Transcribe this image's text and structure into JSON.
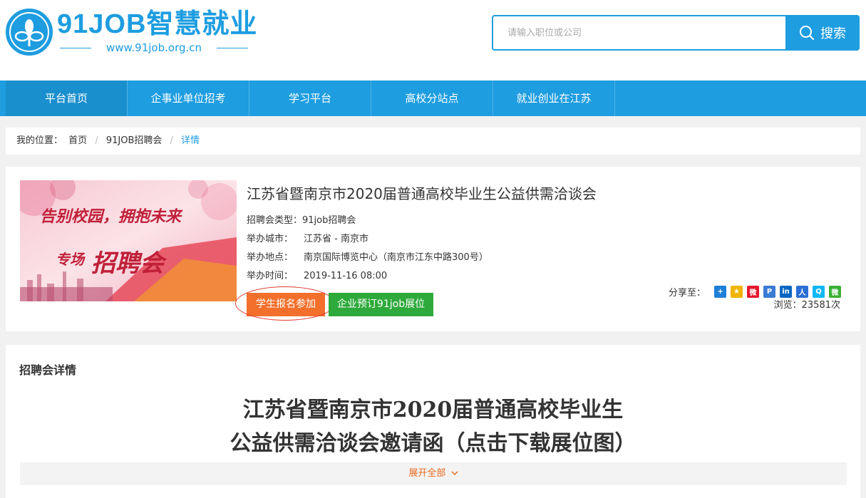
{
  "header": {
    "logo_text": "91JOB智慧就业",
    "logo_url": "www.91job.org.cn",
    "search_placeholder": "请输入职位或公司",
    "search_button": "搜索"
  },
  "nav": {
    "items": [
      {
        "label": "平台首页",
        "active": true
      },
      {
        "label": "企事业单位招考"
      },
      {
        "label": "学习平台"
      },
      {
        "label": "高校分站点"
      },
      {
        "label": "就业创业在江苏"
      }
    ]
  },
  "breadcrumb": {
    "prefix": "我的位置：",
    "items": [
      "首页",
      "91JOB招聘会",
      "详情"
    ]
  },
  "fair": {
    "banner": {
      "line1": "告别校园，拥抱未来",
      "line2a": "专场",
      "line2b": "招聘会"
    },
    "title": "江苏省暨南京市2020届普通高校毕业生公益供需洽谈会",
    "type_label": "招聘会类型：",
    "type_value": "91job招聘会",
    "city_label": "举办城市：",
    "city_value": "江苏省 - 南京市",
    "venue_label": "举办地点：",
    "venue_value": "南京国际博览中心（南京市江东中路300号）",
    "time_label": "举办时间：",
    "time_value": "2019-11-16 08:00",
    "student_button": "学生报名参加",
    "company_button": "企业预订91job展位",
    "share_label": "分享至：",
    "views": "浏览：23581次"
  },
  "detail": {
    "heading": "招聘会详情",
    "doc_title_line1": "江苏省暨南京市2020届普通高校毕业生",
    "doc_title_line2": "公益供需洽谈会邀请函（点击下载展位图）",
    "expand": "展开全部"
  },
  "colors": {
    "brand_blue": "#1e9de0",
    "orange_button": "#f2702c",
    "green_button": "#2ea93b",
    "link_orange": "#e86a1f"
  }
}
